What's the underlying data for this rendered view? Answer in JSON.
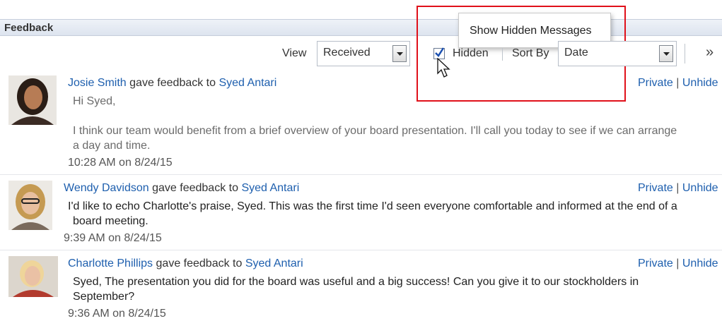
{
  "panel": {
    "title": "Feedback"
  },
  "toolbar": {
    "view_label": "View",
    "view_value": "Received",
    "hidden_label": "Hidden",
    "sort_label": "Sort By",
    "sort_value": "Date",
    "overflow_glyph": "»"
  },
  "tooltip": {
    "text": "Show Hidden Messages"
  },
  "common": {
    "gave_feedback_to": "gave feedback to",
    "private": "Private",
    "pipe": "|",
    "unhide": "Unhide"
  },
  "feedback": [
    {
      "author": "Josie Smith",
      "recipient": "Syed Antari",
      "greeting": "Hi Syed,",
      "message_line1": "I think our team would benefit from a brief overview of your board presentation. I'll call you today to see if we can arrange",
      "message_line2": "a day and time.",
      "timestamp": "10:28 AM on 8/24/15"
    },
    {
      "author": "Wendy Davidson",
      "recipient": "Syed Antari",
      "message_line1": "I'd like to echo Charlotte's praise, Syed. This was the first time I'd seen everyone comfortable and informed at the end of a",
      "message_line2": "board meeting.",
      "timestamp": "9:39 AM on 8/24/15"
    },
    {
      "author": "Charlotte Phillips",
      "recipient": "Syed Antari",
      "message_line1": "Syed, The presentation you did for the board was useful and a big success! Can you give it to our stockholders in",
      "message_line2": "September?",
      "timestamp": "9:36 AM on 8/24/15"
    }
  ],
  "colors": {
    "link": "#1e5fae",
    "highlight_box": "#e0101a",
    "checkbox_check": "#1a4fb0"
  }
}
